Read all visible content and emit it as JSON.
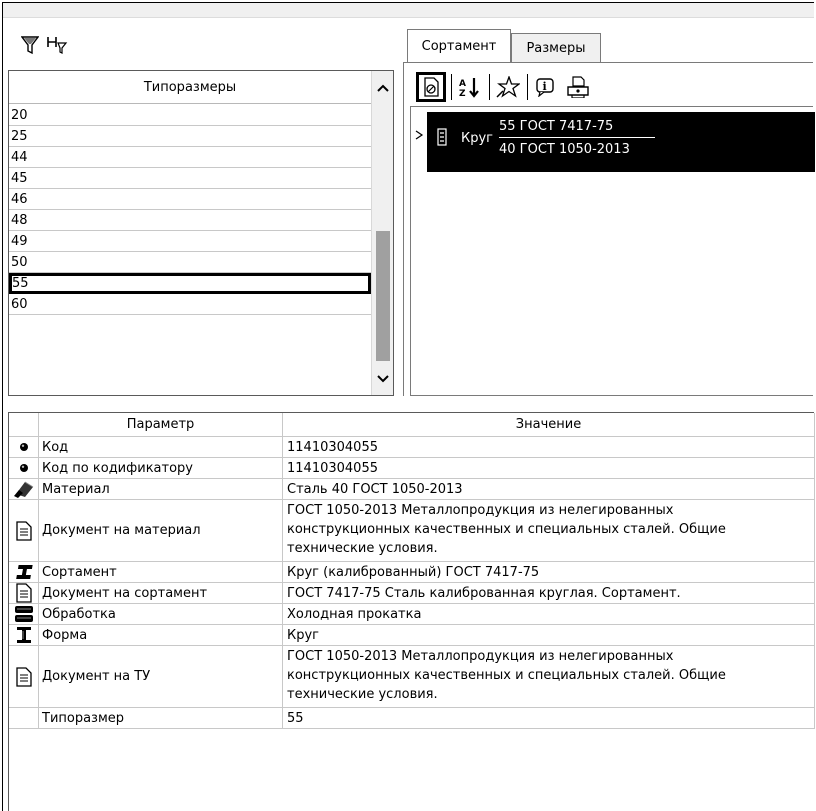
{
  "sizes_list": {
    "header": "Типоразмеры",
    "items": [
      "20",
      "25",
      "44",
      "45",
      "46",
      "48",
      "49",
      "50",
      "55",
      "60"
    ],
    "selected": "55"
  },
  "tabs": [
    {
      "label": "Сортамент",
      "active": true
    },
    {
      "label": "Размеры",
      "active": false
    }
  ],
  "right_toolbar_icons": [
    "document-icon",
    "sort-icon",
    "star-icon",
    "info-icon",
    "print-icon"
  ],
  "assortment_item": {
    "shape": "Круг",
    "numerator": "55 ГОСТ 7417-75",
    "denominator": "40 ГОСТ 1050-2013"
  },
  "params_table": {
    "headers": {
      "name": "Параметр",
      "value": "Значение"
    },
    "rows": [
      {
        "icon": "bullet-icon",
        "name": "Код",
        "value": "11410304055"
      },
      {
        "icon": "bullet-icon",
        "name": "Код по кодификатору",
        "value": "11410304055"
      },
      {
        "icon": "material-icon",
        "name": "Материал",
        "value": "Сталь 40 ГОСТ 1050-2013"
      },
      {
        "icon": "document-icon",
        "name": "Документ на материал",
        "value_lines": [
          "ГОСТ 1050-2013 Металлопродукция из нелегированных",
          "конструкционных качественных и специальных сталей. Общие",
          "технические условия."
        ]
      },
      {
        "icon": "profile-icon",
        "name": "Сортамент",
        "value": "Круг (калиброванный) ГОСТ 7417-75"
      },
      {
        "icon": "document-icon",
        "name": "Документ на сортамент",
        "value": "ГОСТ 7417-75 Сталь калиброванная круглая. Сортамент."
      },
      {
        "icon": "processing-icon",
        "name": "Обработка",
        "value": "Холодная прокатка"
      },
      {
        "icon": "shape-icon",
        "name": "Форма",
        "value": "Круг"
      },
      {
        "icon": "document-icon",
        "name": "Документ на ТУ",
        "value_lines": [
          "ГОСТ 1050-2013 Металлопродукция из нелегированных",
          "конструкционных качественных и специальных сталей. Общие",
          "технические условия."
        ]
      },
      {
        "icon": "",
        "name": "Типоразмер",
        "value": "55"
      }
    ]
  }
}
